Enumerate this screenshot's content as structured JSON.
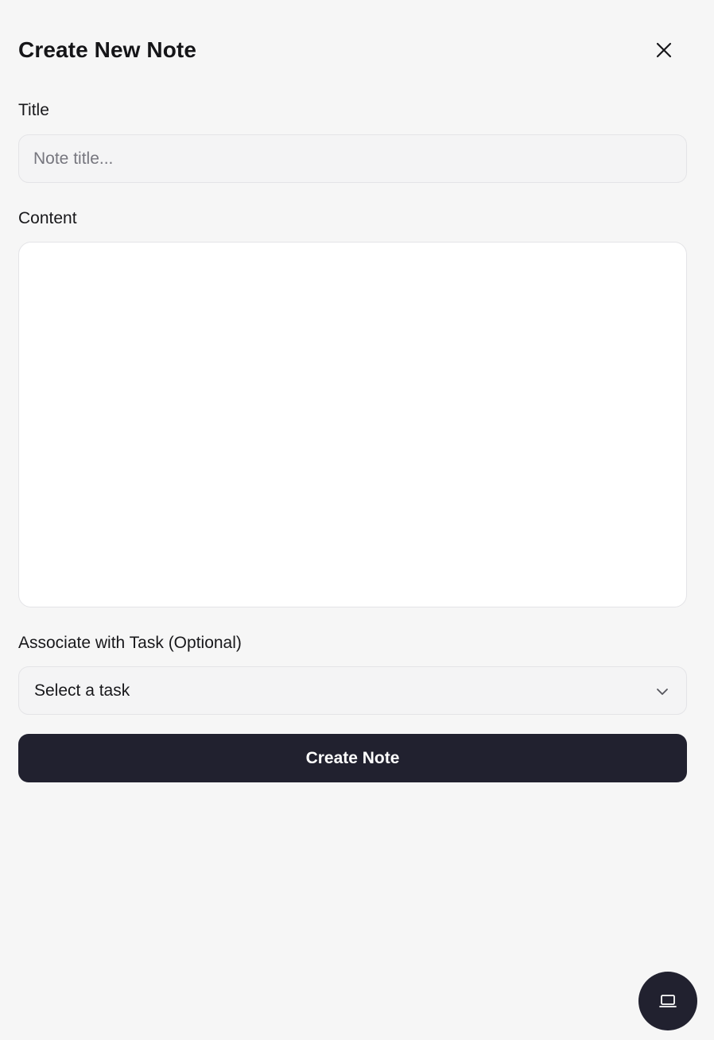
{
  "dialog": {
    "title": "Create New Note",
    "close_icon": "close-icon"
  },
  "form": {
    "title_label": "Title",
    "title_placeholder": "Note title...",
    "title_value": "",
    "content_label": "Content",
    "content_value": "",
    "task_label": "Associate with Task (Optional)",
    "task_selected": "Select a task",
    "task_chevron_icon": "chevron-down-icon",
    "submit_label": "Create Note"
  },
  "fab": {
    "icon": "laptop-icon"
  },
  "colors": {
    "background": "#f6f6f6",
    "input_background": "#f4f4f5",
    "border": "#e4e4e7",
    "primary_button": "#21212f",
    "primary_button_text": "#ffffff"
  }
}
